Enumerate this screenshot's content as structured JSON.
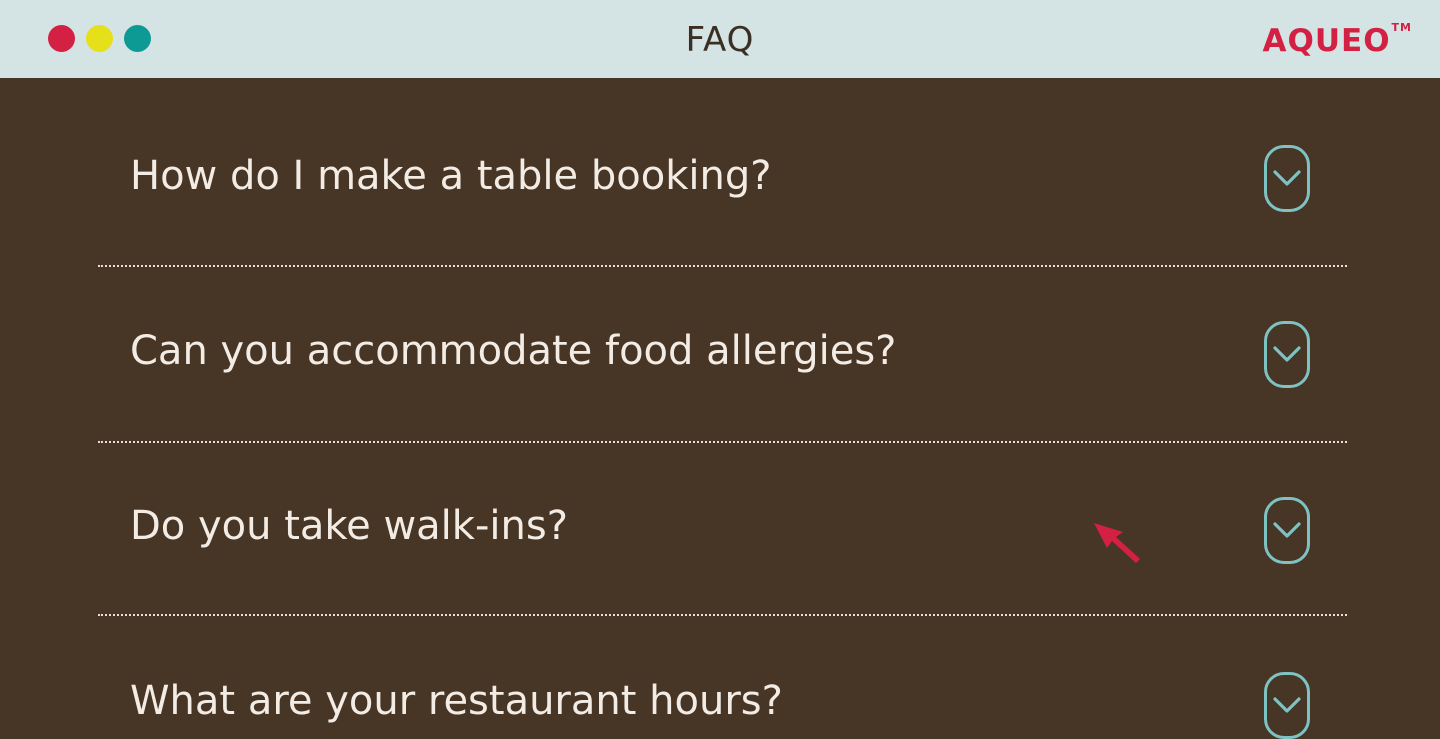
{
  "window": {
    "title": "FAQ",
    "controls": [
      {
        "name": "close",
        "color": "#d42043"
      },
      {
        "name": "minimize",
        "color": "#e6e01a"
      },
      {
        "name": "maximize",
        "color": "#0e9a94"
      }
    ]
  },
  "brand": {
    "logo_text": "AQUEO",
    "trademark": "TM",
    "color": "#d42043"
  },
  "faq": {
    "items": [
      {
        "question": "How do I make a table booking?",
        "icon": "chevron-down-icon"
      },
      {
        "question": "Can you accommodate food allergies?",
        "icon": "chevron-down-icon"
      },
      {
        "question": "Do you take walk-ins?",
        "icon": "chevron-down-icon"
      },
      {
        "question": "What are your restaurant hours?",
        "icon": "chevron-down-icon"
      }
    ]
  },
  "colors": {
    "background": "#473526",
    "titlebar": "#d4e3e4",
    "accent": "#7ec3c3",
    "cursor": "#d42043"
  }
}
